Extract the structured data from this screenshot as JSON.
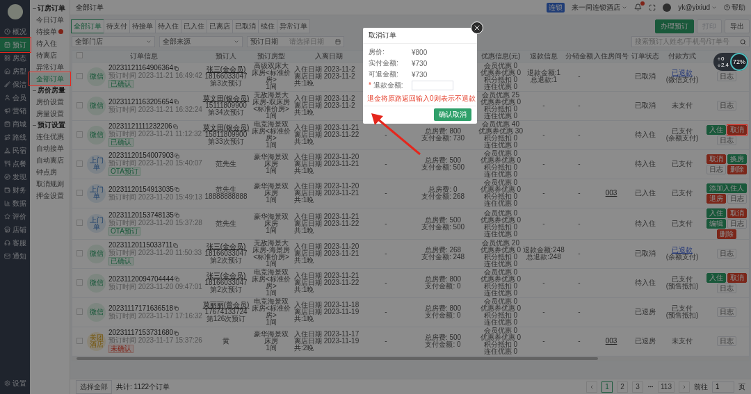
{
  "nav": {
    "items": [
      {
        "label": "概况",
        "selected": false
      },
      {
        "label": "预订",
        "selected": true,
        "annotated": true
      },
      {
        "label": "房态",
        "selected": false
      },
      {
        "label": "房型",
        "selected": false
      },
      {
        "label": "保洁",
        "selected": false
      },
      {
        "label": "会员",
        "selected": false
      },
      {
        "label": "营销",
        "selected": false
      },
      {
        "label": "商城",
        "selected": false
      },
      {
        "label": "路线",
        "selected": false
      },
      {
        "label": "民宿",
        "selected": false
      },
      {
        "label": "点餐",
        "selected": false
      },
      {
        "label": "发现",
        "selected": false
      },
      {
        "label": "财务",
        "selected": false
      },
      {
        "label": "数据",
        "selected": false
      },
      {
        "label": "评价",
        "selected": false
      },
      {
        "label": "店铺",
        "selected": false
      },
      {
        "label": "客服",
        "selected": false
      },
      {
        "label": "通知",
        "selected": false
      }
    ],
    "footer": {
      "label": "设置"
    }
  },
  "subnav": {
    "groups": [
      {
        "title": "订房订单",
        "expanded": true,
        "items": [
          {
            "label": "今日订单",
            "selected": false
          },
          {
            "label": "待接单",
            "selected": false,
            "badge_dot": true
          },
          {
            "label": "待入住",
            "selected": false
          },
          {
            "label": "待离店",
            "selected": false
          },
          {
            "label": "异常订单",
            "selected": false
          },
          {
            "label": "全部订单",
            "selected": true,
            "annotated": true
          }
        ]
      },
      {
        "title": "房价房量",
        "expanded": true,
        "items": [
          {
            "label": "房价设置",
            "selected": false
          },
          {
            "label": "房量设置",
            "selected": false
          }
        ]
      },
      {
        "title": "预订设置",
        "expanded": true,
        "items": [
          {
            "label": "连住优惠",
            "selected": false
          },
          {
            "label": "自动接单",
            "selected": false
          },
          {
            "label": "自动离店",
            "selected": false
          },
          {
            "label": "钟点房",
            "selected": false
          },
          {
            "label": "取消规则",
            "selected": false
          },
          {
            "label": "押金设置",
            "selected": false
          }
        ]
      }
    ]
  },
  "header": {
    "title": "全部订单",
    "store_tag": "连锁",
    "store": "来一间连锁酒店",
    "notification_dot": true,
    "user": "yk@yixiud",
    "help": "帮助"
  },
  "tabs": [
    {
      "label": "全部订单",
      "selected": true
    },
    {
      "label": "待支付",
      "selected": false
    },
    {
      "label": "待接单",
      "selected": false
    },
    {
      "label": "待入住",
      "selected": false
    },
    {
      "label": "已入住",
      "selected": false
    },
    {
      "label": "已离店",
      "selected": false
    },
    {
      "label": "已取消",
      "selected": false
    },
    {
      "label": "续住",
      "selected": false
    },
    {
      "label": "异常订单",
      "selected": false
    }
  ],
  "actions": [
    {
      "label": "办理预订",
      "kind": "primary"
    },
    {
      "label": "打印",
      "kind": "disabled"
    },
    {
      "label": "导出",
      "kind": "plain"
    }
  ],
  "filters": {
    "store": "全部门店",
    "source": "全部来源",
    "date_type": "预订日期",
    "date_placeholder": "请选择日期",
    "search_placeholder": "搜索预订人姓名/手机号/订单号"
  },
  "table": {
    "select_all_checked": false,
    "columns": [
      {
        "label": "订单信息"
      },
      {
        "label": "预订人"
      },
      {
        "label": "预订房型"
      },
      {
        "label": "入离日期"
      },
      {},
      {},
      {
        "label": "优惠信息(元)"
      },
      {
        "label": "退款信息"
      },
      {
        "label": "分销金额"
      },
      {
        "label": "入住房间号"
      },
      {
        "label": "订单状态"
      },
      {
        "label": "付款方式"
      }
    ],
    "rows": [
      {
        "checked": false,
        "source": {
          "label": "微信",
          "kind": "wechat"
        },
        "order_no": "20231121164906364",
        "order_time": "预订时间 2023-11-21 16:49:42",
        "tag": {
          "label": "已确认",
          "kind": "ok"
        },
        "guest": [
          "张三(金会员)",
          "18166033047",
          "第3次预订"
        ],
        "name_link": true,
        "room_type": "高级双床大床房<标准价房>",
        "room_count": "1间",
        "dates": [
          "入住日期 2023-11-2",
          "离店日期 2023-11-2",
          "共:1晚"
        ],
        "discounts": [
          "会员优惠 0",
          "优惠券优惠 0",
          "积分抵扣 0",
          "连住优惠 0"
        ],
        "refund": [
          "退款金额:1",
          "总退款:1"
        ],
        "distribution": "-",
        "status": "已取消",
        "payment": {
          "label": "已退款",
          "link": true,
          "note": "(微信支付)"
        },
        "ops": [
          {
            "label": "日志",
            "kind": "plain"
          }
        ]
      },
      {
        "checked": false,
        "source": {
          "label": "微信",
          "kind": "wechat"
        },
        "order_no": "20231121163205654",
        "order_time": "预订时间 2023-11-21 16:32:24",
        "guest": [
          "莫文田(银会员)",
          "15111809900",
          "第34次预订"
        ],
        "name_link": true,
        "room_type": "无敌海景大床房-双床房<标准价房>",
        "room_count": "1间",
        "dates": [
          "入住日期 2023-11-2",
          "离店日期 2023-11-2",
          "共:1晚"
        ],
        "discounts": [
          "会员优惠 25",
          "优惠券优惠 0",
          "积分抵扣 0",
          "连住优惠 0"
        ],
        "refund": [
          "-"
        ],
        "distribution": "-",
        "status": "已取消",
        "payment": {
          "label": "未支付",
          "link": false
        },
        "ops": [
          {
            "label": "日志",
            "kind": "plain"
          }
        ]
      },
      {
        "checked": false,
        "source": {
          "label": "微信",
          "kind": "wechat"
        },
        "order_no": "20231121111232206",
        "order_time": "预订时间 2023-11-21 11:12:32",
        "tag": {
          "label": "已确认",
          "kind": "ok"
        },
        "guest": [
          "莫文田(银会员)",
          "15811809900",
          "第33次预订"
        ],
        "name_link": true,
        "room_type": "电竞海景双床房<标准价房>",
        "room_count": "1间",
        "dates": [
          "入住日期 2023-11-21",
          "离店日期 2023-11-22",
          "共:1晚"
        ],
        "blank": "-",
        "fee": [
          "总房费: 800",
          "支付金额: 730"
        ],
        "discounts": [
          "会员优惠 40",
          "优惠券优惠 30",
          "积分抵扣 0",
          "连住优惠 0"
        ],
        "refund": [
          "-"
        ],
        "distribution": "-",
        "status": "待入住",
        "payment": {
          "label": "已支付",
          "link": false,
          "note": "(余额支付)"
        },
        "ops": [
          {
            "label": "入住",
            "kind": "success"
          },
          {
            "label": "取消",
            "kind": "danger",
            "annotated": true
          },
          {
            "label": "日志",
            "kind": "plain"
          }
        ]
      },
      {
        "checked": false,
        "source": {
          "label": "上门单",
          "kind": "walkin"
        },
        "order_no": "20231120154007903",
        "order_time": "预订时间 2023-11-20 15:40:07",
        "tag": {
          "label": "OTA预订",
          "kind": "ok"
        },
        "guest": [
          "范先生"
        ],
        "name_link": false,
        "room_type": "豪华海景双床房",
        "room_count": "1间",
        "dates": [
          "入住日期 2023-11-20",
          "离店日期 2023-11-21",
          "共:1晚"
        ],
        "blank": "-",
        "fee": [
          "总房费: 500",
          "支付金额: 500"
        ],
        "discounts": [
          "会员优惠 0",
          "优惠券优惠 0",
          "积分抵扣 0",
          "连住优惠 0"
        ],
        "refund": [
          "-"
        ],
        "distribution": "-",
        "status": "待入住",
        "payment": {
          "label": "已支付",
          "link": false
        },
        "ops": [
          {
            "label": "取消",
            "kind": "danger"
          },
          {
            "label": "换房",
            "kind": "success"
          },
          {
            "label": "日志",
            "kind": "plain"
          },
          {
            "label": "删除",
            "kind": "danger"
          }
        ]
      },
      {
        "checked": false,
        "source": {
          "label": "上门单",
          "kind": "walkin"
        },
        "order_no": "20231120154913035",
        "order_time": "预订时间 2023-11-20 15:49:13",
        "guest": [
          "范先生",
          "18888888888"
        ],
        "name_link": false,
        "room_type": "豪华海景双床房",
        "room_count": "1间",
        "dates": [
          "入住日期 2023-11-20",
          "离店日期 2023-11-21",
          "共:1晚"
        ],
        "blank": "-",
        "fee": [
          "总房费: 0",
          "支付金额: 268"
        ],
        "discounts": [
          "会员优惠 0",
          "优惠券优惠 0",
          "积分抵扣 0",
          "连住优惠 0"
        ],
        "refund": [
          "-"
        ],
        "distribution": "-",
        "room_no": "003",
        "status": "已入住",
        "payment": {
          "label": "已支付",
          "link": false
        },
        "ops": [
          {
            "label": "添加入住人",
            "kind": "success"
          },
          {
            "label": "退房",
            "kind": "danger"
          },
          {
            "label": "日志",
            "kind": "plain"
          }
        ]
      },
      {
        "checked": false,
        "source": {
          "label": "上门单",
          "kind": "walkin"
        },
        "order_no": "20231120153748135",
        "order_time": "预订时间 2023-11-20 15:37:28",
        "tag": {
          "label": "OTA预订",
          "kind": "ok"
        },
        "guest": [
          "范先生"
        ],
        "name_link": false,
        "room_type": "豪华海景双床房",
        "room_count": "1间",
        "dates": [
          "入住日期 2023-11-21",
          "离店日期 2023-11-22",
          "共:1晚"
        ],
        "blank": "-",
        "fee": [
          "总房费: 500",
          "支付金额: 500"
        ],
        "discounts": [
          "会员优惠 0",
          "优惠券优惠 0",
          "积分抵扣 0",
          "连住优惠 0"
        ],
        "refund": [
          "-"
        ],
        "distribution": "-",
        "status": "待入住",
        "payment": {
          "label": "已支付",
          "link": false
        },
        "ops": [
          {
            "label": "入住",
            "kind": "success"
          },
          {
            "label": "取消",
            "kind": "danger"
          },
          {
            "label": "编辑",
            "kind": "success"
          },
          {
            "label": "日志",
            "kind": "plain"
          },
          {
            "label": "删除",
            "kind": "danger"
          }
        ]
      },
      {
        "checked": false,
        "source": {
          "label": "微信",
          "kind": "wechat"
        },
        "order_no": "20231120115033711",
        "order_time": "预订时间 2023-11-20 11:50:33",
        "tag": {
          "label": "已确认",
          "kind": "ok"
        },
        "guest": [
          "张三(金会员)",
          "18166033047",
          "第2次预订"
        ],
        "name_link": true,
        "room_type": "无敌海景大床房-海景房<标准价房>",
        "room_count": "1间",
        "dates": [
          "入住日期 2023-11-20",
          "离店日期 2023-11-21",
          "共:1晚"
        ],
        "blank": "-",
        "fee": [
          "总房费: 268",
          "支付金额: 248"
        ],
        "discounts": [
          "会员优惠 20",
          "优惠券优惠 0",
          "积分抵扣 0",
          "连住优惠 0"
        ],
        "refund": [
          "退款金额:248",
          "总退款:248"
        ],
        "distribution": "-",
        "status": "已取消",
        "payment": {
          "label": "已退款",
          "link": true,
          "note": "(余额支付)"
        },
        "ops": [
          {
            "label": "日志",
            "kind": "plain"
          }
        ]
      },
      {
        "checked": false,
        "source": {
          "label": "微信",
          "kind": "wechat"
        },
        "order_no": "20231120094704444",
        "order_time": "预订时间 2023-11-20 09:47:01",
        "guest": [
          "张三(金会员)",
          "18166033047",
          "第2次预订"
        ],
        "name_link": true,
        "room_type": "电竞海景双床房<标准价房>",
        "room_count": "1间",
        "dates": [
          "入住日期 2023-11-21",
          "离店日期 2023-11-22",
          "共:1晚"
        ],
        "blank": "-",
        "fee": [
          "总房费: 800",
          "支付金额: 0"
        ],
        "discounts": [
          "会员优惠 0",
          "优惠券优惠 0",
          "积分抵扣 0",
          "连住优惠 0"
        ],
        "refund": [
          "-"
        ],
        "distribution": "-",
        "status": "待入住",
        "payment": {
          "label": "已支付",
          "link": false,
          "note": "(预售抵扣)"
        },
        "ops": [
          {
            "label": "入住",
            "kind": "success"
          },
          {
            "label": "取消",
            "kind": "danger"
          },
          {
            "label": "日志",
            "kind": "plain"
          }
        ]
      },
      {
        "checked": false,
        "source": {
          "label": "微信",
          "kind": "wechat"
        },
        "order_no": "20231117171636518",
        "order_time": "预订时间 2023-11-17 17:16:32",
        "guest": [
          "莫丽丽(普会员)",
          "17674133724",
          "第126次预订"
        ],
        "name_link": true,
        "room_type": "电竞海景双床房<标准价房>",
        "room_count": "1间",
        "dates": [
          "入住日期 2023-11-18",
          "离店日期 2023-11-19",
          "共:1晚"
        ],
        "blank": "-",
        "fee": [
          "总房费: 800",
          "支付金额: 0"
        ],
        "discounts": [
          "会员优惠 0",
          "优惠券优惠 0",
          "积分抵扣 0",
          "连住优惠 0"
        ],
        "refund": [
          "-"
        ],
        "distribution": "-",
        "status": "已退房",
        "payment": {
          "label": "已支付",
          "link": false,
          "note": "(预售抵扣)"
        },
        "ops": [
          {
            "label": "日志",
            "kind": "plain"
          }
        ]
      },
      {
        "checked": false,
        "source": {
          "label": "美团酒店",
          "kind": "meituan"
        },
        "order_no": "20231117153731680",
        "order_time": "预订时间 2023-11-17 15:37:26",
        "tag": {
          "label": "未确认",
          "kind": "warn"
        },
        "guest": [
          "黄"
        ],
        "name_link": false,
        "room_type": "豪华海景双床房",
        "room_count": "1间",
        "dates": [
          "入住日期 2023-11-17",
          "离店日期 2023-11-19",
          "共:2晚"
        ],
        "blank": "-",
        "fee": [
          "总房费: 500",
          "支付金额: 0"
        ],
        "discounts": [
          "会员优惠 0",
          "优惠券优惠 0",
          "积分抵扣 0",
          "连住优惠 0"
        ],
        "refund": [
          "-"
        ],
        "distribution": "-",
        "room_no": "003",
        "status": "已退房",
        "payment": {
          "label": "未支付",
          "link": false
        },
        "ops": [
          {
            "label": "日志",
            "kind": "plain"
          }
        ]
      }
    ]
  },
  "footer": {
    "select_all": "选择全部",
    "total": "共计: 1122个订单",
    "pages": [
      {
        "label": "1",
        "selected": true
      },
      {
        "label": "2",
        "selected": false
      },
      {
        "label": "3",
        "selected": false
      },
      {
        "label": "113",
        "selected": false
      }
    ],
    "goto": "前往",
    "goto_value": "1",
    "page_unit": "页"
  },
  "monitor": {
    "up": "0",
    "down": "2.4",
    "percent": "72%"
  },
  "dialog": {
    "title": "取消订单",
    "lines": [
      {
        "label": "房价:",
        "value": "¥800"
      },
      {
        "label": "实付金额:",
        "value": "¥730"
      },
      {
        "label": "可退金额:",
        "value": "¥730"
      }
    ],
    "field": {
      "required_mark": "*",
      "label": "退款金额:"
    },
    "notice": "退金将原路返回输入0则表示不退款",
    "confirm": "确认取消"
  }
}
